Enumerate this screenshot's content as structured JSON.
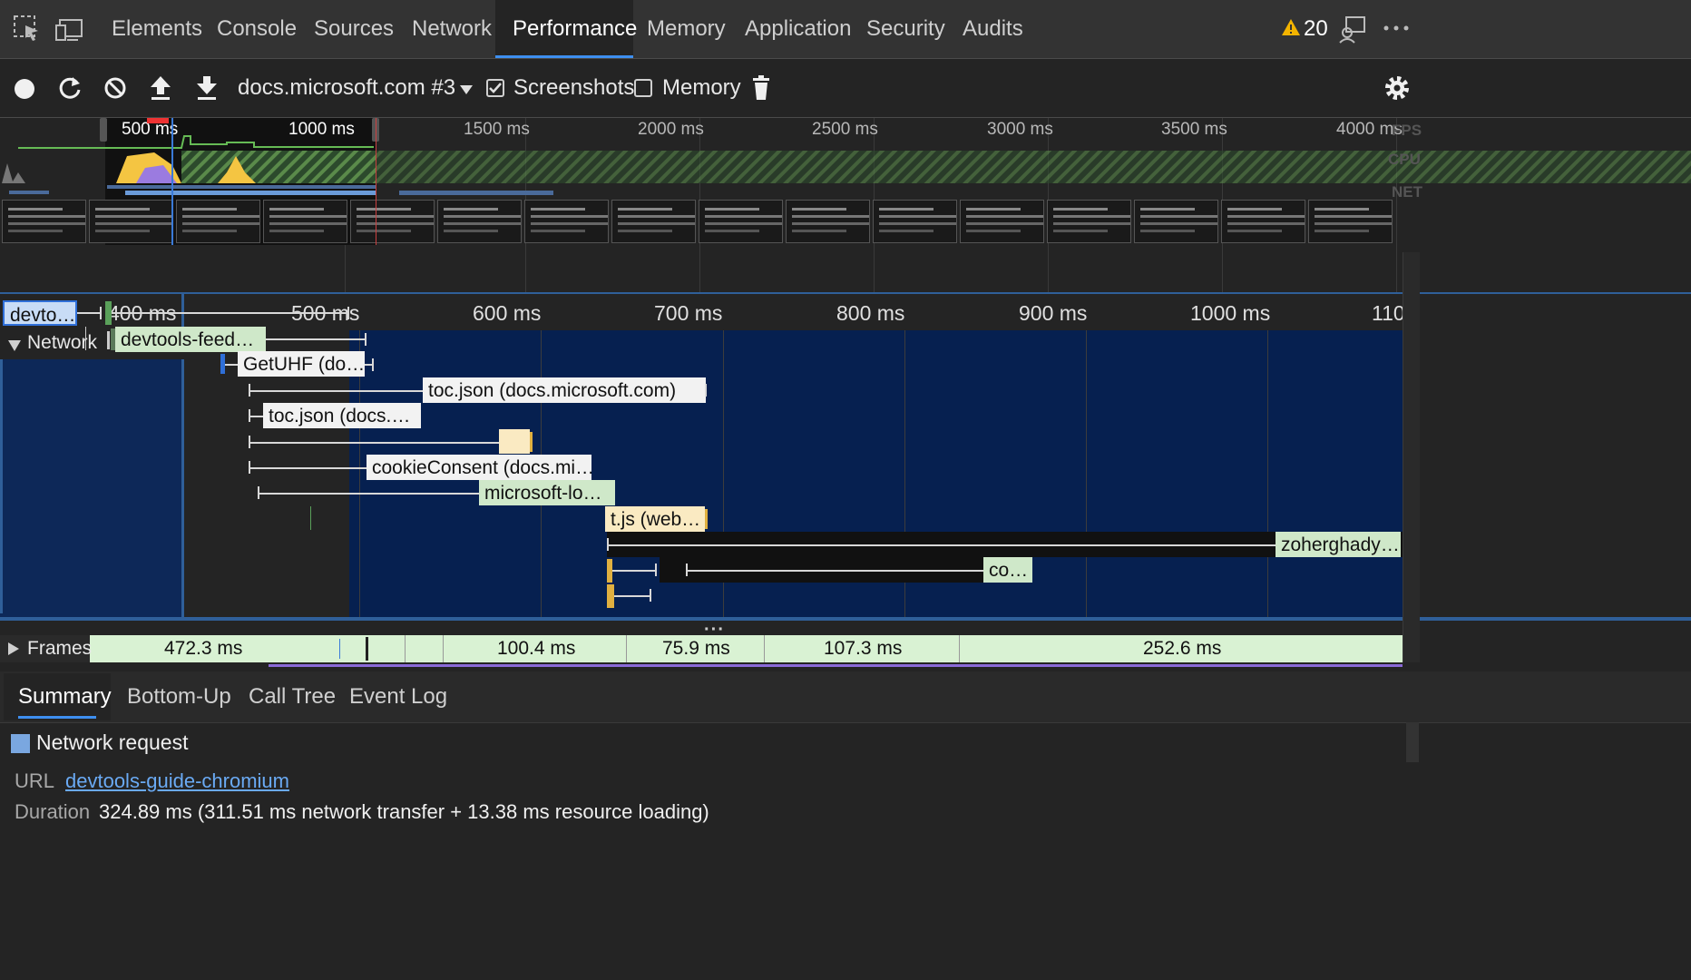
{
  "tabs": {
    "items": [
      "Elements",
      "Console",
      "Sources",
      "Network",
      "Performance",
      "Memory",
      "Application",
      "Security",
      "Audits"
    ],
    "active": "Performance",
    "warning_count": "20"
  },
  "toolbar": {
    "profile_select": "docs.microsoft.com #3",
    "screenshots_label": "Screenshots",
    "screenshots_checked": true,
    "memory_label": "Memory",
    "memory_checked": false
  },
  "overview": {
    "ticks": [
      "500 ms",
      "1000 ms",
      "1500 ms",
      "2000 ms",
      "2500 ms",
      "3000 ms",
      "3500 ms",
      "4000 ms"
    ],
    "track_labels": [
      "FPS",
      "CPU",
      "NET"
    ],
    "screenshot_count": 16
  },
  "ruler": {
    "ticks": [
      "400 ms",
      "500 ms",
      "600 ms",
      "700 ms",
      "800 ms",
      "900 ms",
      "1000 ms",
      "110"
    ]
  },
  "network": {
    "title": "Network",
    "requests": [
      "devto…",
      "devtools-feed…",
      "GetUHF (do…",
      "toc.json (docs.microsoft.com)",
      "toc.json (docs.…",
      "cookieConsent (docs.mi…",
      "microsoft-lo…",
      "t.js (web…",
      "zoherghady…",
      "co…"
    ]
  },
  "frames": {
    "title": "Frames",
    "durations": [
      "472.3 ms",
      "100.4 ms",
      "75.9 ms",
      "107.3 ms",
      "252.6 ms"
    ]
  },
  "bottom_tabs": {
    "items": [
      "Summary",
      "Bottom-Up",
      "Call Tree",
      "Event Log"
    ],
    "active": "Summary"
  },
  "summary": {
    "title": "Network request",
    "url_label": "URL",
    "url_value": "devtools-guide-chromium",
    "duration_label": "Duration",
    "duration_value": "324.89 ms (311.51 ms network transfer + 13.38 ms resource loading)",
    "color": "#7aa7e0"
  }
}
